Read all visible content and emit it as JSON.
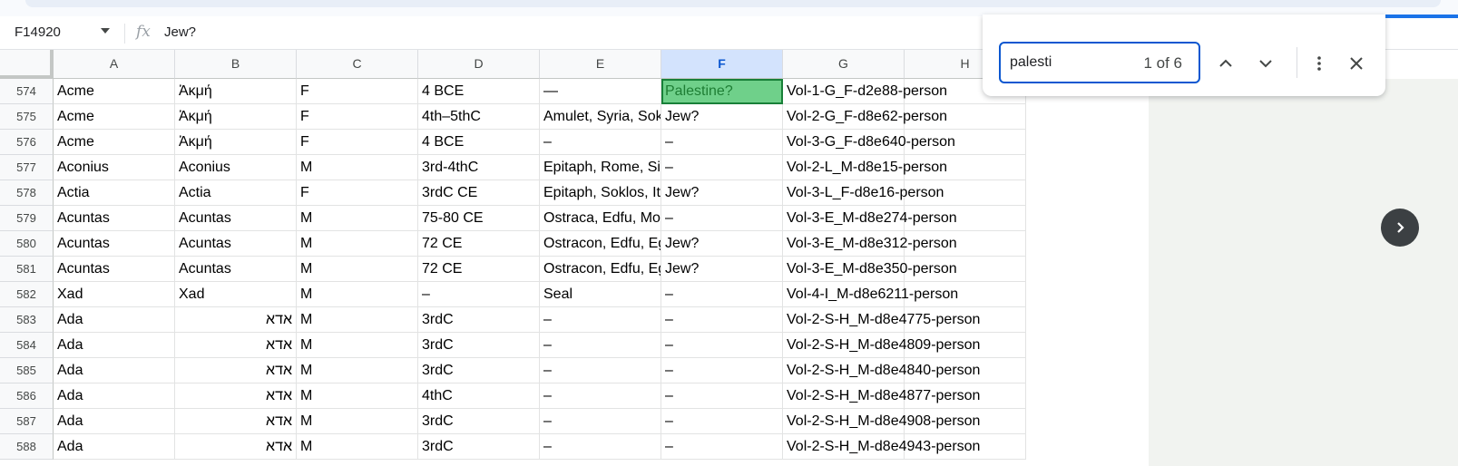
{
  "formula_bar": {
    "cell_ref": "F14920",
    "fx_label": "fx",
    "formula": "Jew?"
  },
  "columns": [
    {
      "label": "A",
      "selected": false
    },
    {
      "label": "B",
      "selected": false
    },
    {
      "label": "C",
      "selected": false
    },
    {
      "label": "D",
      "selected": false
    },
    {
      "label": "E",
      "selected": false
    },
    {
      "label": "F",
      "selected": true
    },
    {
      "label": "G",
      "selected": false
    },
    {
      "label": "H",
      "selected": false
    }
  ],
  "rows": [
    {
      "num": "574",
      "cells": [
        "Acme",
        "Ἀκμή",
        "F",
        "4 BCE",
        "—",
        "Palestine?",
        "Vol-1-G_F-d2e88-person",
        ""
      ]
    },
    {
      "num": "575",
      "cells": [
        "Acme",
        "Ἀκμή",
        "F",
        "4th–5thC",
        "Amulet, Syria, Soknopaiou",
        "Jew?",
        "Vol-2-G_F-d8e62-person",
        ""
      ]
    },
    {
      "num": "576",
      "cells": [
        "Acme",
        "Ἀκμή",
        "F",
        "4 BCE",
        "–",
        "–",
        "Vol-3-G_F-d8e640-person",
        ""
      ]
    },
    {
      "num": "577",
      "cells": [
        "Aconius",
        "Aconius",
        "M",
        "3rd-4thC",
        "Epitaph, Rome, Sicily",
        "–",
        "Vol-2-L_M-d8e15-person",
        ""
      ]
    },
    {
      "num": "578",
      "cells": [
        "Actia",
        "Actia",
        "F",
        "3rdC CE",
        "Epitaph, Soklos, Italy",
        "Jew?",
        "Vol-3-L_F-d8e16-person",
        ""
      ]
    },
    {
      "num": "579",
      "cells": [
        "Acuntas",
        "Acuntas",
        "M",
        "75-80 CE",
        "Ostraca, Edfu, Mother",
        "–",
        "Vol-3-E_M-d8e274-person",
        ""
      ]
    },
    {
      "num": "580",
      "cells": [
        "Acuntas",
        "Acuntas",
        "M",
        "72 CE",
        "Ostracon, Edfu, Egypt",
        "Jew?",
        "Vol-3-E_M-d8e312-person",
        ""
      ]
    },
    {
      "num": "581",
      "cells": [
        "Acuntas",
        "Acuntas",
        "M",
        "72 CE",
        "Ostracon, Edfu, Egypt",
        "Jew?",
        "Vol-3-E_M-d8e350-person",
        ""
      ]
    },
    {
      "num": "582",
      "cells": [
        "Xad",
        "Xad",
        "M",
        "–",
        "Seal",
        "–",
        "Vol-4-I_M-d8e6211-person",
        ""
      ]
    },
    {
      "num": "583",
      "cells": [
        "Ada",
        "אדא",
        "M",
        "3rdC",
        "–",
        "–",
        "Vol-2-S-H_M-d8e4775-person",
        ""
      ]
    },
    {
      "num": "584",
      "cells": [
        "Ada",
        "אדא",
        "M",
        "3rdC",
        "–",
        "–",
        "Vol-2-S-H_M-d8e4809-person",
        ""
      ]
    },
    {
      "num": "585",
      "cells": [
        "Ada",
        "אדא",
        "M",
        "3rdC",
        "–",
        "–",
        "Vol-2-S-H_M-d8e4840-person",
        ""
      ]
    },
    {
      "num": "586",
      "cells": [
        "Ada",
        "אדא",
        "M",
        "4thC",
        "–",
        "–",
        "Vol-2-S-H_M-d8e4877-person",
        ""
      ]
    },
    {
      "num": "587",
      "cells": [
        "Ada",
        "אדא",
        "M",
        "3rdC",
        "–",
        "–",
        "Vol-2-S-H_M-d8e4908-person",
        ""
      ]
    },
    {
      "num": "588",
      "cells": [
        "Ada",
        "אדא",
        "M",
        "3rdC",
        "–",
        "–",
        "Vol-2-S-H_M-d8e4943-person",
        ""
      ]
    }
  ],
  "find": {
    "query": "palesti",
    "count": "1 of 6",
    "icons": [
      "chevron-up-icon",
      "chevron-down-icon",
      "more-vert-icon",
      "close-icon"
    ]
  },
  "colors": {
    "accent": "#0b57d0",
    "match_fill": "#6fd08a",
    "match_border": "#188038",
    "selected_col": "#d3e3fd"
  }
}
